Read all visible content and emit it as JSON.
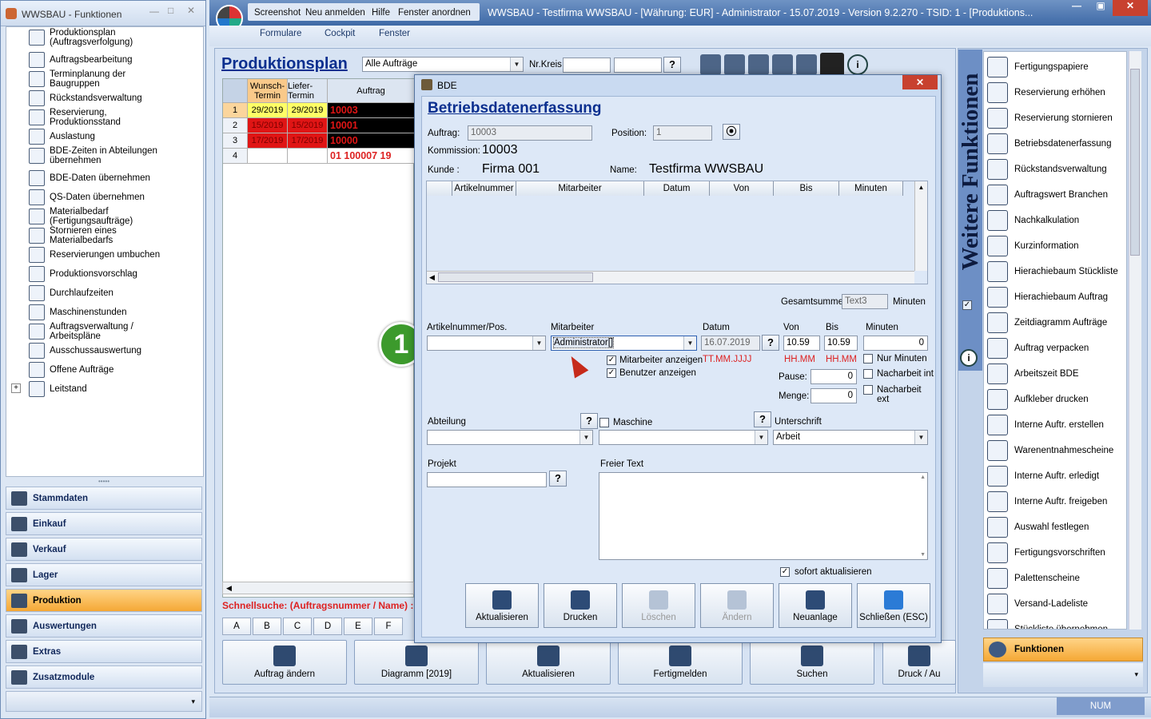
{
  "left_window": {
    "title": "WWSBAU - Funktionen",
    "tree": [
      {
        "label": "Produktionsplan (Auftragsverfolgung)",
        "icon": "gantt-icon"
      },
      {
        "label": "Auftragsbearbeitung",
        "icon": "order-edit-icon"
      },
      {
        "label": "Terminplanung der Baugruppen",
        "icon": "schedule-icon"
      },
      {
        "label": "Rückstandsverwaltung",
        "icon": "backlog-icon"
      },
      {
        "label": "Reservierung, Produktionsstand",
        "icon": "reservation-icon"
      },
      {
        "label": "Auslastung",
        "icon": "utilization-icon"
      },
      {
        "label": "BDE-Zeiten in Abteilungen übernehmen",
        "icon": "bde-times-icon"
      },
      {
        "label": "BDE-Daten übernehmen",
        "icon": "bde-data-icon"
      },
      {
        "label": "QS-Daten übernehmen",
        "icon": "qs-data-icon"
      },
      {
        "label": "Materialbedarf (Fertigungsaufträge)",
        "icon": "material-icon"
      },
      {
        "label": "Stornieren eines Materialbedarfs",
        "icon": "cancel-material-icon"
      },
      {
        "label": "Reservierungen umbuchen",
        "icon": "rebook-icon"
      },
      {
        "label": "Produktionsvorschlag",
        "icon": "proposal-icon"
      },
      {
        "label": "Durchlaufzeiten",
        "icon": "hourglass-icon"
      },
      {
        "label": "Maschinenstunden",
        "icon": "machine-hours-icon"
      },
      {
        "label": "Auftragsverwaltung / Arbeitspläne",
        "icon": "workplan-icon"
      },
      {
        "label": "Ausschussauswertung",
        "icon": "waste-icon"
      },
      {
        "label": "Offene Aufträge",
        "icon": "open-orders-icon"
      },
      {
        "label": "Leitstand",
        "icon": "control-center-icon"
      }
    ],
    "nav": [
      "Stammdaten",
      "Einkauf",
      "Verkauf",
      "Lager",
      "Produktion",
      "Auswertungen",
      "Extras",
      "Zusatzmodule"
    ],
    "nav_active": "Produktion"
  },
  "main_window": {
    "menu": [
      "Screenshot",
      "Neu anmelden",
      "Hilfe",
      "Fenster anordnen"
    ],
    "title": "WWSBAU - Testfirma WWSBAU - [Währung: EUR] - Administrator - 15.07.2019 - Version 9.2.270 - TSID: 1 - [Produktions...",
    "toolbar": [
      "Formulare",
      "Cockpit",
      "Fenster"
    ],
    "heading": "Produktionsplan",
    "filter": "Alle Aufträge",
    "nrkreis_label": "Nr.Kreis",
    "headers": [
      "Wunsch-Termin",
      "Liefer-Termin",
      "Auftrag"
    ],
    "rows": [
      {
        "n": "1",
        "w": "29/2019",
        "l": "29/2019",
        "a": "10003"
      },
      {
        "n": "2",
        "w": "15/2019",
        "l": "15/2019",
        "a": "10001"
      },
      {
        "n": "3",
        "w": "17/2019",
        "l": "17/2019",
        "a": "10000"
      },
      {
        "n": "4",
        "w": "",
        "l": "",
        "a": "01 100007 19"
      }
    ],
    "quicksearch": "Schnellsuche: (Auftragsnummer / Name) :",
    "letters": [
      "A",
      "B",
      "C",
      "D",
      "E",
      "F"
    ],
    "bottom_buttons": [
      "Auftrag ändern",
      "Diagramm [2019]",
      "Aktualisieren",
      "Fertigmelden",
      "Suchen",
      "Druck / Au"
    ],
    "status": "NUM"
  },
  "dialog": {
    "title": "BDE",
    "heading": "Betriebsdatenerfassung",
    "auftrag_label": "Auftrag:",
    "auftrag": "10003",
    "position_label": "Position:",
    "position": "1",
    "kommission_label": "Kommission:",
    "kommission": "10003",
    "kunde_label": "Kunde :",
    "kunde": "Firma 001",
    "name_label": "Name:",
    "name": "Testfirma WWSBAU",
    "grid_headers": [
      "Artikelnummer",
      "Mitarbeiter",
      "Datum",
      "Von",
      "Bis",
      "Minuten"
    ],
    "gesamt_label": "Gesamtsumme:",
    "gesamt": "Text3",
    "minuten_unit": "Minuten",
    "artikel_label": "Artikelnummer/Pos.",
    "mitarbeiter_label": "Mitarbeiter",
    "mitarbeiter": "Administrator[]",
    "datum_label": "Datum",
    "datum": "16.07.2019",
    "datum_hint": "TT.MM.JJJJ",
    "von_label": "Von",
    "von": "10.59",
    "von_hint": "HH.MM",
    "bis_label": "Bis",
    "bis": "10.59",
    "bis_hint": "HH.MM",
    "minuten_label": "Minuten",
    "minuten": "0",
    "chk_mitarbeiter": "Mitarbeiter anzeigen",
    "chk_benutzer": "Benutzer anzeigen",
    "chk_nurmin": "Nur Minuten",
    "chk_nint": "Nacharbeit int",
    "chk_next": "Nacharbeit ext",
    "pause_label": "Pause:",
    "pause": "0",
    "menge_label": "Menge:",
    "menge": "0",
    "abteilung_label": "Abteilung",
    "maschine_label": "Maschine",
    "unterschrift_label": "Unterschrift",
    "unterschrift": "Arbeit",
    "projekt_label": "Projekt",
    "freitext_label": "Freier Text",
    "sofort_label": "sofort aktualisieren",
    "buttons": [
      "Aktualisieren",
      "Drucken",
      "Löschen",
      "Ändern",
      "Neuanlage",
      "Schließen (ESC)"
    ],
    "callout": "1"
  },
  "right_panel": {
    "vertical_title": "Weitere Funktionen",
    "items": [
      "Fertigungspapiere",
      "Reservierung erhöhen",
      "Reservierung stornieren",
      "Betriebsdatenerfassung",
      "Rückstandsverwaltung",
      "Auftragswert Branchen",
      "Nachkalkulation",
      "Kurzinformation",
      "Hierachiebaum Stückliste",
      "Hierachiebaum Auftrag",
      "Zeitdiagramm Aufträge",
      "Auftrag verpacken",
      "Arbeitszeit BDE",
      "Aufkleber drucken",
      "Interne Auftr. erstellen",
      "Warenentnahmescheine",
      "Interne Auftr. erledigt",
      "Interne Auftr. freigeben",
      "Auswahl festlegen",
      "Fertigungsvorschriften",
      "Palettenscheine",
      "Versand-Ladeliste",
      "Stückliste übernehmen"
    ],
    "footer": "Funktionen"
  },
  "colors": {
    "accent_orange": "#f5a835",
    "title_blue": "#0b2f8f",
    "hint_red": "#d22222",
    "callout_green": "#3c9a2c"
  }
}
